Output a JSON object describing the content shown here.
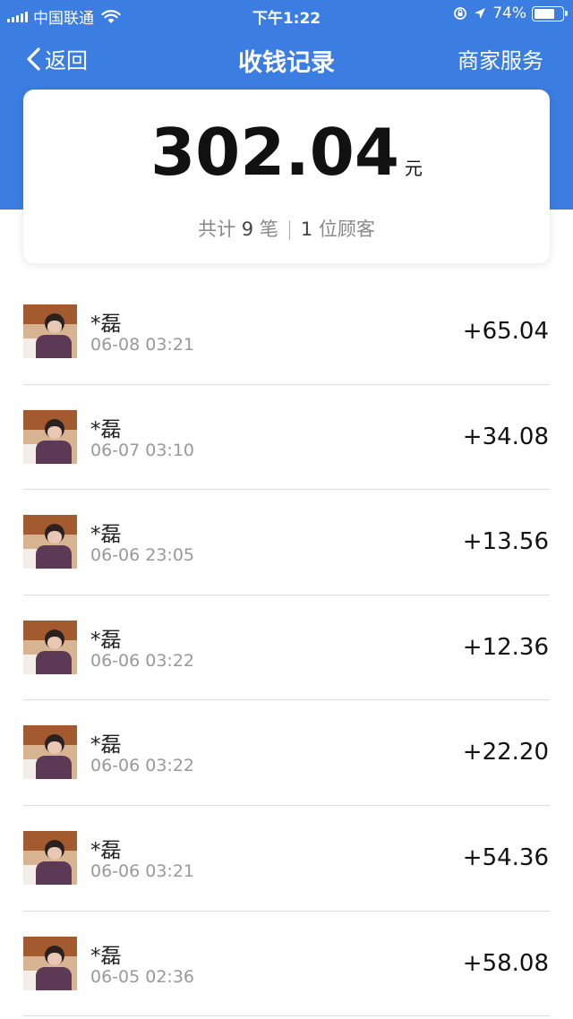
{
  "status_bar": {
    "carrier": "中国联通",
    "time": "下午1:22",
    "battery": "74%",
    "battery_level": 0.74
  },
  "nav": {
    "back_label": "返回",
    "title": "收钱记录",
    "merchant_label": "商家服务"
  },
  "summary": {
    "total_amount": "302.04",
    "unit": "元",
    "count_prefix": "共计",
    "count": "9",
    "count_suffix": "笔",
    "customer_count": "1",
    "customer_suffix": "位顾客"
  },
  "transactions": [
    {
      "name": "*磊",
      "time": "06-08 03:21",
      "amount": "+65.04"
    },
    {
      "name": "*磊",
      "time": "06-07 03:10",
      "amount": "+34.08"
    },
    {
      "name": "*磊",
      "time": "06-06 23:05",
      "amount": "+13.56"
    },
    {
      "name": "*磊",
      "time": "06-06 03:22",
      "amount": "+12.36"
    },
    {
      "name": "*磊",
      "time": "06-06 03:22",
      "amount": "+22.20"
    },
    {
      "name": "*磊",
      "time": "06-06 03:21",
      "amount": "+54.36"
    },
    {
      "name": "*磊",
      "time": "06-05 02:36",
      "amount": "+58.08"
    }
  ],
  "colors": {
    "header_blue": "#3b7de0",
    "amount_text": "#111111",
    "secondary_text": "#999999"
  },
  "icons": {
    "back": "chevron-left-icon",
    "wifi": "wifi-icon",
    "signal": "signal-icon",
    "location": "location-arrow-icon",
    "lock": "rotation-lock-icon",
    "battery": "battery-icon"
  }
}
